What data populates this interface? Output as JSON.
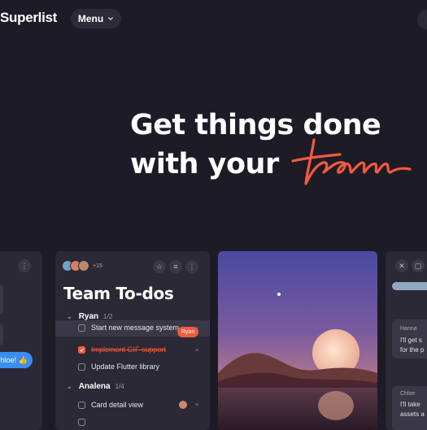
{
  "header": {
    "logo": "Superlist",
    "menu_label": "Menu"
  },
  "hero": {
    "line1": "Get things done",
    "line2": "with your",
    "script_word": "team",
    "accent_color": "#f35a3c"
  },
  "left_card": {
    "message": "Chloe! 👍"
  },
  "todo_card": {
    "avatar_count": "+15",
    "title": "Team To-dos",
    "sections": [
      {
        "name": "Ryan",
        "count": "1/2",
        "tasks": [
          {
            "label": "Start new message system",
            "done": false,
            "assignee_tag": "Ryan"
          },
          {
            "label": "Implement GIF support",
            "done": true
          },
          {
            "label": "Update Flutter library",
            "done": false
          }
        ]
      },
      {
        "name": "Analena",
        "count": "1/4",
        "tasks": [
          {
            "label": "Card detail view",
            "done": false
          }
        ]
      }
    ]
  },
  "right_card": {
    "msg1_name": "Hanna",
    "msg1_line1": "I'll get s",
    "msg1_line2": "for the p",
    "msg2_name": "Chloe",
    "msg2_line1": "I'll take",
    "msg2_line2": "assets a"
  }
}
